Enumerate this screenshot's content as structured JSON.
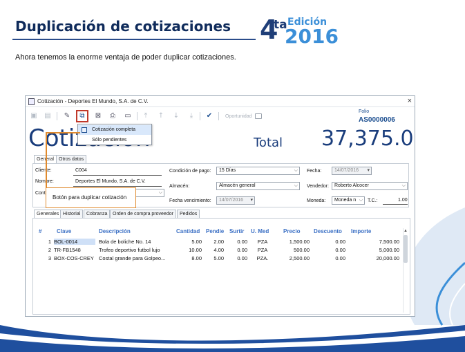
{
  "slide": {
    "title": "Duplicación de cotizaciones",
    "edition_number": "4",
    "edition_suffix": "ta",
    "edition_word": "Edición",
    "edition_year": "2016",
    "subtitle": "Ahora tenemos la enorme ventaja de poder duplicar cotizaciones.",
    "colors": {
      "title": "#0f2b5b",
      "accent": "#3b8fd8",
      "callout": "#e08a2d",
      "highlight": "#c0392b"
    }
  },
  "window": {
    "title": "Cotización - Deportes El Mundo, S.A. de C.V.",
    "close_glyph": "×",
    "toolbar": {
      "oportunidad_label": "Oportunidad",
      "icons": [
        "save-icon",
        "save-close-icon",
        "edit-icon",
        "duplicate-icon",
        "delete-icon",
        "print-icon",
        "preview-icon",
        "move-first-icon",
        "move-up-icon",
        "move-down-icon",
        "move-last-icon",
        "check-icon",
        "folder-icon"
      ]
    },
    "folio": {
      "label": "Folio",
      "value": "AS0000006"
    },
    "heading": "Cotización",
    "total_label": "Total",
    "total_value": "37,375.00",
    "dropdown": {
      "items": [
        {
          "label": "Cotización completa",
          "active": true
        },
        {
          "label": "Sólo pendientes",
          "active": false
        }
      ]
    },
    "top_tabs": [
      "General",
      "Otros datos"
    ],
    "form": {
      "cliente_label": "Cliente:",
      "cliente_value": "C004",
      "nombre_label": "Nombre:",
      "nombre_value": "Deportes El Mundo, S.A. de C.V.",
      "contacto_label": "Contacto:",
      "condicion_label": "Condición de pago:",
      "condicion_value": "15 Días",
      "almacen_label": "Almacén:",
      "almacen_value": "Almacén general",
      "vencimiento_label": "Fecha vencimiento:",
      "vencimiento_value": "14/07/2016",
      "fecha_label": "Fecha:",
      "fecha_value": "14/07/2016",
      "vendedor_label": "Vendedor:",
      "vendedor_value": "Roberto Alcocer",
      "moneda_label": "Moneda:",
      "moneda_value": "Moneda n",
      "tc_label": "T.C.:",
      "tc_value": "1.00"
    },
    "callout_text": "Botón para duplicar cotización",
    "bottom_tabs": [
      "Generales",
      "Historial",
      "Cobranza",
      "Orden de compra proveedor",
      "Pedidos"
    ],
    "table": {
      "headers": [
        "#",
        "Clave",
        "Descripción",
        "Cantidad",
        "Pendie",
        "Surtir",
        "U. Med",
        "Precio",
        "Descuento",
        "Importe"
      ],
      "rows": [
        [
          "1",
          "BOL-0014",
          "Bola de boliche No. 14",
          "5.00",
          "2.00",
          "0.00",
          "PZA",
          "1,500.00",
          "0.00",
          "7,500.00"
        ],
        [
          "2",
          "TR-FB1548",
          "Trofeo deportivo futbol lujo",
          "10.00",
          "4.00",
          "0.00",
          "PZA",
          "500.00",
          "0.00",
          "5,000.00"
        ],
        [
          "3",
          "BOX-COS-CREY",
          "Costal grande para Golpeo...",
          "8.00",
          "5.00",
          "0.00",
          "PZA.",
          "2,500.00",
          "0.00",
          "20,000.00"
        ]
      ]
    }
  }
}
